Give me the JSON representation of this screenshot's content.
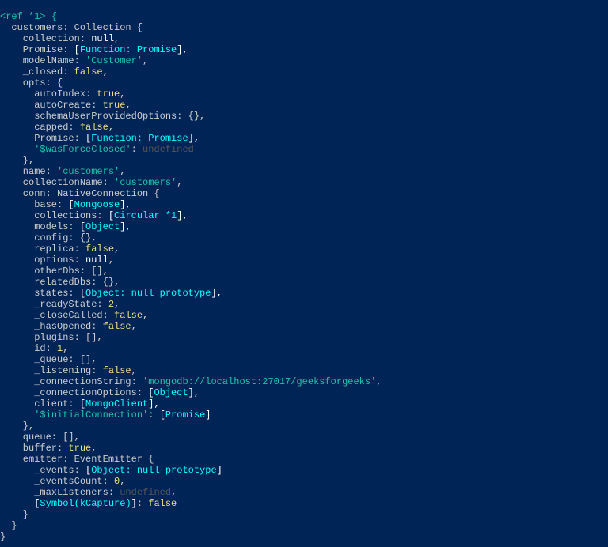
{
  "l0": "<ref *1> {",
  "l1_a": "  customers: Collection {",
  "l2_k": "    collection: ",
  "l2_v": "null",
  "l2_s": ",",
  "l3_k": "    Promise: ",
  "l3_b1": "[",
  "l3_f": "Function: Promise",
  "l3_b2": "],",
  "l4_k": "    modelName: ",
  "l4_v": "'Customer'",
  "l4_s": ",",
  "l5_k": "    _closed: ",
  "l5_v": "false",
  "l5_s": ",",
  "l6_k": "    opts: {",
  "l7_k": "      autoIndex: ",
  "l7_v": "true",
  "l7_s": ",",
  "l8_k": "      autoCreate: ",
  "l8_v": "true",
  "l8_s": ",",
  "l9_k": "      schemaUserProvidedOptions: {},",
  "l10_k": "      capped: ",
  "l10_v": "false",
  "l10_s": ",",
  "l11_k": "      Promise: ",
  "l11_b1": "[",
  "l11_f": "Function: Promise",
  "l11_b2": "],",
  "l12_k": "      ",
  "l12_q": "'$wasForceClosed'",
  "l12_c": ": ",
  "l12_v": "undefined",
  "l13": "    },",
  "l14_k": "    name: ",
  "l14_v": "'customers'",
  "l14_s": ",",
  "l15_k": "    collectionName: ",
  "l15_v": "'customers'",
  "l15_s": ",",
  "l16": "    conn: NativeConnection {",
  "l17_k": "      base: ",
  "l17_b1": "[",
  "l17_f": "Mongoose",
  "l17_b2": "],",
  "l18_k": "      collections: ",
  "l18_b1": "[",
  "l18_f": "Circular *1",
  "l18_b2": "],",
  "l19_k": "      models: ",
  "l19_b1": "[",
  "l19_f": "Object",
  "l19_b2": "],",
  "l20_k": "      config: {},",
  "l21_k": "      replica: ",
  "l21_v": "false",
  "l21_s": ",",
  "l22_k": "      options: ",
  "l22_v": "null",
  "l22_s": ",",
  "l23_k": "      otherDbs: [],",
  "l24_k": "      relatedDbs: {},",
  "l25_k": "      states: ",
  "l25_b1": "[",
  "l25_f": "Object: null prototype",
  "l25_b2": "],",
  "l26_k": "      _readyState: ",
  "l26_v": "2",
  "l26_s": ",",
  "l27_k": "      _closeCalled: ",
  "l27_v": "false",
  "l27_s": ",",
  "l28_k": "      _hasOpened: ",
  "l28_v": "false",
  "l28_s": ",",
  "l29_k": "      plugins: [],",
  "l30_k": "      id: ",
  "l30_v": "1",
  "l30_s": ",",
  "l31_k": "      _queue: [],",
  "l32_k": "      _listening: ",
  "l32_v": "false",
  "l32_s": ",",
  "l33_k": "      _connectionString: ",
  "l33_v": "'mongodb://localhost:27017/geeksforgeeks'",
  "l33_s": ",",
  "l34_k": "      _connectionOptions: ",
  "l34_b1": "[",
  "l34_f": "Object",
  "l34_b2": "],",
  "l35_k": "      client: ",
  "l35_b1": "[",
  "l35_f": "MongoClient",
  "l35_b2": "],",
  "l36_k": "      ",
  "l36_q": "'$initialConnection'",
  "l36_c": ": ",
  "l36_b1": "[",
  "l36_f": "Promise",
  "l36_b2": "]",
  "l37": "    },",
  "l38_k": "    queue: [],",
  "l39_k": "    buffer: ",
  "l39_v": "true",
  "l39_s": ",",
  "l40": "    emitter: EventEmitter {",
  "l41_k": "      _events: ",
  "l41_b1": "[",
  "l41_f": "Object: null prototype",
  "l41_b2": "]",
  " l41_r": " {},",
  "l42_k": "      _eventsCount: ",
  "l42_v": "0",
  "l42_s": ",",
  "l43_k": "      _maxListeners: ",
  "l43_v": "undefined",
  "l43_s": ",",
  "l44_k": "      ",
  "l44_b1": "[",
  "l44_f": "Symbol(kCapture)",
  "l44_b2": "]",
  "l44_c": ": ",
  "l44_v": "false",
  "l45": "    }",
  "l46": "  }",
  "l47": "}"
}
